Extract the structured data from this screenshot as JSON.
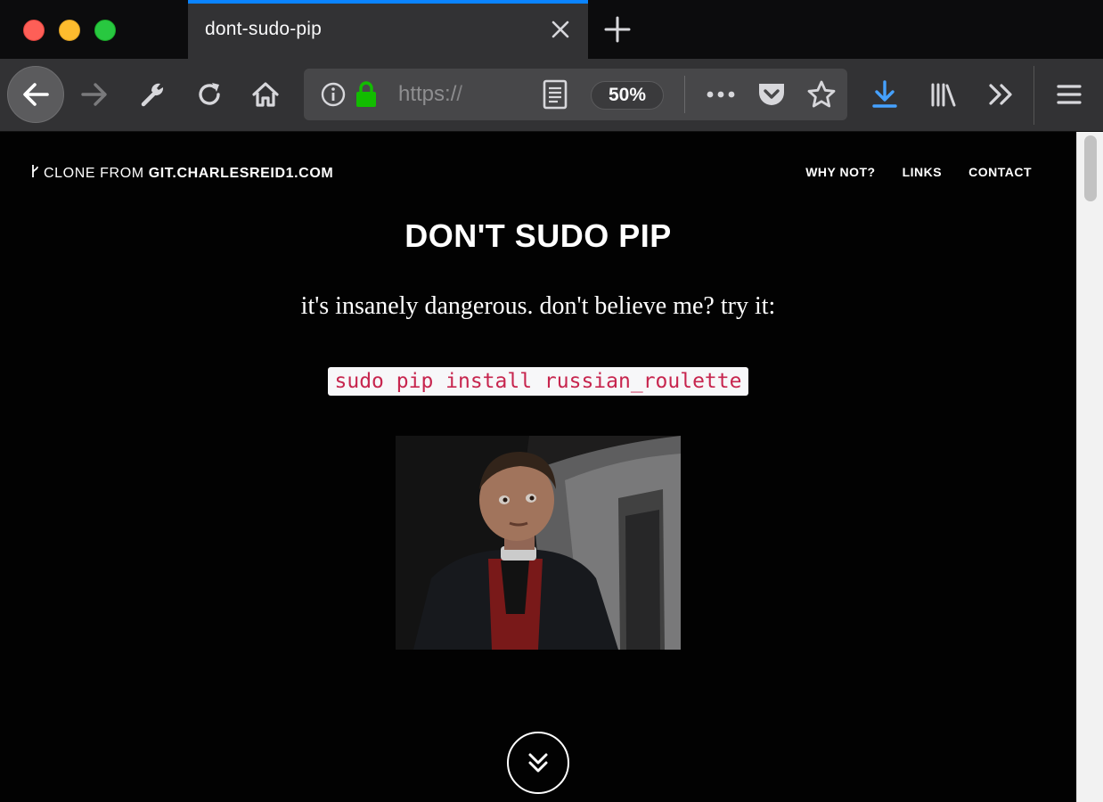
{
  "window": {
    "tab_title": "dont-sudo-pip"
  },
  "toolbar": {
    "url_text": "https://",
    "zoom_level": "50%",
    "accent_color": "#0a84ff",
    "lock_color": "#12bc00"
  },
  "icons": {
    "back": "back-arrow-icon",
    "forward": "forward-arrow-icon",
    "tools": "wrench-icon",
    "reload": "reload-icon",
    "home": "home-icon",
    "info": "info-icon",
    "lock": "lock-icon",
    "reader": "reader-view-icon",
    "more": "more-dots-icon",
    "pocket": "pocket-icon",
    "bookmark": "star-icon",
    "downloads": "download-icon",
    "library": "library-icon",
    "overflow": "chevrons-right-icon",
    "menu": "hamburger-menu-icon"
  },
  "site": {
    "brand_prefix": "CLONE FROM ",
    "brand_domain": "GIT.CHARLESREID1.COM",
    "nav": [
      "WHY NOT?",
      "LINKS",
      "CONTACT"
    ]
  },
  "hero": {
    "title": "DON'T SUDO PIP",
    "subtitle": "it's insanely dangerous. don't believe me? try it:",
    "code": "sudo pip install russian_roulette"
  }
}
